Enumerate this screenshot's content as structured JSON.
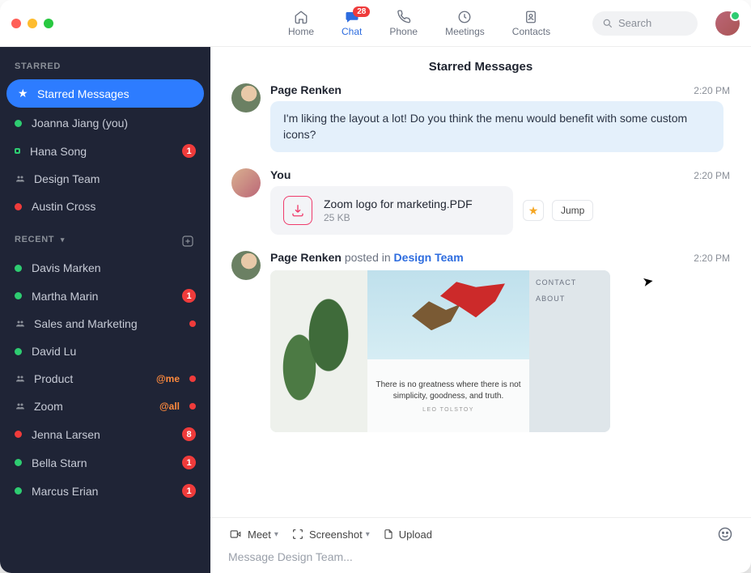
{
  "topnav": {
    "items": [
      {
        "label": "Home"
      },
      {
        "label": "Chat",
        "badge": "28",
        "active": true
      },
      {
        "label": "Phone"
      },
      {
        "label": "Meetings"
      },
      {
        "label": "Contacts"
      }
    ]
  },
  "search": {
    "placeholder": "Search"
  },
  "sidebar": {
    "starred_label": "STARRED",
    "recent_label": "RECENT",
    "starred": [
      {
        "name": "Starred Messages",
        "active": true,
        "icon": "star"
      },
      {
        "name": "Joanna Jiang (you)",
        "presence": "online"
      },
      {
        "name": "Hana Song",
        "presence": "away",
        "count": "1"
      },
      {
        "name": "Design Team",
        "group": true
      },
      {
        "name": "Austin Cross",
        "presence": "dnd"
      }
    ],
    "recent": [
      {
        "name": "Davis Marken",
        "presence": "online"
      },
      {
        "name": "Martha Marin",
        "presence": "online",
        "count": "1"
      },
      {
        "name": "Sales and Marketing",
        "group": true,
        "dot": true
      },
      {
        "name": "David Lu",
        "presence": "online"
      },
      {
        "name": "Product",
        "group": true,
        "mention": "@me",
        "dot": true
      },
      {
        "name": "Zoom",
        "group": true,
        "mention": "@all",
        "dot": true
      },
      {
        "name": "Jenna Larsen",
        "presence": "dnd",
        "count": "8"
      },
      {
        "name": "Bella Starn",
        "presence": "online",
        "count": "1"
      },
      {
        "name": "Marcus Erian",
        "presence": "online",
        "count": "1"
      }
    ]
  },
  "header": {
    "title": "Starred Messages"
  },
  "messages": [
    {
      "author": "Page Renken",
      "time": "2:20 PM",
      "avatar": "page",
      "bubble": "I'm liking the layout a lot! Do you think the menu would benefit with some custom icons?"
    },
    {
      "author": "You",
      "time": "2:20 PM",
      "avatar": "you",
      "file": {
        "name": "Zoom logo for marketing.PDF",
        "size": "25 KB"
      },
      "jump_label": "Jump"
    },
    {
      "author": "Page Renken",
      "posted_in_verb": "posted in",
      "posted_in": "Design Team",
      "time": "2:20 PM",
      "avatar": "page",
      "preview": {
        "menu": [
          "CONTACT",
          "ABOUT"
        ],
        "quote": "There is no greatness where there is not simplicity, goodness, and truth.",
        "quote_author": "LEO TOLSTOY"
      }
    }
  ],
  "composer": {
    "meet": "Meet",
    "screenshot": "Screenshot",
    "upload": "Upload",
    "placeholder": "Message Design Team..."
  }
}
